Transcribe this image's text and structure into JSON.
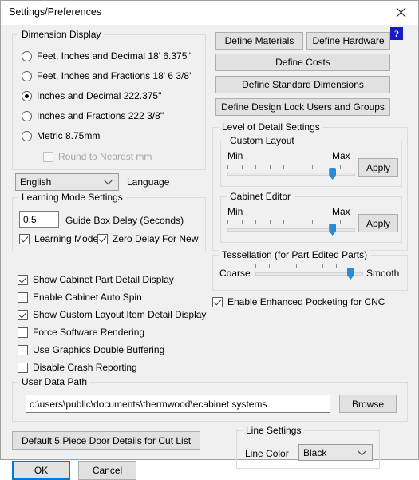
{
  "window": {
    "title": "Settings/Preferences",
    "close_icon": "close-icon"
  },
  "dimension_display": {
    "legend": "Dimension Display",
    "options": [
      {
        "label": "Feet, Inches and Decimal 18' 6.375''",
        "selected": false
      },
      {
        "label": "Feet, Inches and Fractions 18' 6 3/8''",
        "selected": false
      },
      {
        "label": "Inches and Decimal 222.375''",
        "selected": true
      },
      {
        "label": "Inches and Fractions 222 3/8''",
        "selected": false
      },
      {
        "label": "Metric 8.75mm",
        "selected": false
      }
    ],
    "round_to_nearest": {
      "label": "Round to Nearest mm",
      "checked": false,
      "enabled": false
    }
  },
  "language": {
    "value": "English",
    "label": "Language",
    "options": [
      "English"
    ]
  },
  "learning_mode": {
    "legend": "Learning Mode Settings",
    "guide_box_delay_value": "0.5",
    "guide_box_delay_label": "Guide Box Delay (Seconds)",
    "checkboxes": [
      {
        "label": "Learning Mode",
        "checked": true
      },
      {
        "label": "Zero Delay For New",
        "checked": true
      }
    ]
  },
  "display_options": [
    {
      "label": "Show Cabinet Part Detail Display",
      "checked": true
    },
    {
      "label": "Enable Cabinet Auto Spin",
      "checked": false
    },
    {
      "label": "Show Custom Layout Item Detail Display",
      "checked": true
    },
    {
      "label": "Force Software Rendering",
      "checked": false
    },
    {
      "label": "Use Graphics Double Buffering",
      "checked": false
    },
    {
      "label": "Disable Crash Reporting",
      "checked": false
    }
  ],
  "define_buttons": [
    {
      "label": "Define Materials"
    },
    {
      "label": "Define Hardware"
    },
    {
      "label": "Define Costs"
    },
    {
      "label": "Define Standard Dimensions"
    },
    {
      "label": "Define Design Lock Users and Groups"
    }
  ],
  "help": {
    "glyph": "?"
  },
  "level_of_detail": {
    "legend": "Level of Detail Settings",
    "custom_layout": {
      "legend": "Custom Layout",
      "min_label": "Min",
      "max_label": "Max",
      "value_percent": 82,
      "tick_count": 9,
      "apply_label": "Apply"
    },
    "cabinet_editor": {
      "legend": "Cabinet Editor",
      "min_label": "Min",
      "max_label": "Max",
      "value_percent": 82,
      "tick_count": 9,
      "apply_label": "Apply"
    }
  },
  "tessellation": {
    "legend": "Tessellation (for Part Edited Parts)",
    "min_label": "Coarse",
    "max_label": "Smooth",
    "value_percent": 88,
    "tick_count": 8
  },
  "enhanced_pocketing": {
    "label": "Enable Enhanced Pocketing for CNC",
    "checked": true
  },
  "user_data_path": {
    "legend": "User Data Path",
    "value": "c:\\users\\public\\documents\\thermwood\\ecabinet systems",
    "placeholder": "",
    "browse_label": "Browse"
  },
  "cut_list_button": {
    "label": "Default 5 Piece Door Details for Cut List"
  },
  "line_settings": {
    "legend": "Line Settings",
    "line_color_label": "Line Color",
    "line_color_value": "Black",
    "options": [
      "Black"
    ]
  },
  "footer": {
    "ok_label": "OK",
    "cancel_label": "Cancel"
  },
  "colors": {
    "accent": "#0078d7",
    "slider_thumb": "#2a8ad4",
    "help_blue": "#1b1bc4",
    "dialog_bg": "#f0f0f0"
  }
}
